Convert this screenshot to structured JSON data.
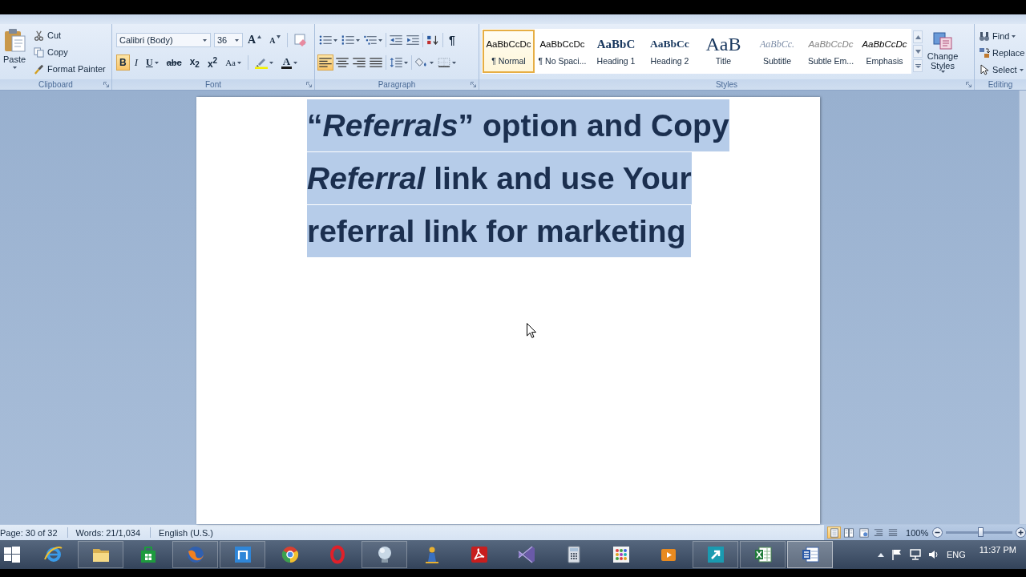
{
  "ribbon": {
    "clipboard": {
      "label": "Clipboard",
      "paste": "Paste",
      "actions": [
        {
          "kind": "cut",
          "label": "Cut"
        },
        {
          "kind": "copy",
          "label": "Copy"
        },
        {
          "kind": "format-painter",
          "label": "Format Painter"
        }
      ]
    },
    "font": {
      "label": "Font",
      "font_name": "Calibri (Body)",
      "font_size": "36",
      "size_tools": [
        {
          "kind": "grow",
          "label": "A"
        },
        {
          "kind": "shrink",
          "label": "A"
        },
        {
          "kind": "clear"
        }
      ],
      "format": [
        {
          "kind": "bold",
          "label": "B",
          "selected": true
        },
        {
          "kind": "italic",
          "label": "I",
          "selected": false
        },
        {
          "kind": "underline",
          "label": "U",
          "selected": false
        },
        {
          "kind": "strikethrough",
          "label": "abc",
          "selected": false
        },
        {
          "kind": "subscript",
          "label": "x$_{2}$",
          "selected": false
        },
        {
          "kind": "superscript",
          "label": "x$^{2}$",
          "selected": false
        },
        {
          "kind": "change-case",
          "label": "Aa"
        }
      ],
      "colors": [
        {
          "kind": "highlight"
        },
        {
          "kind": "font-color",
          "label": "A"
        }
      ]
    },
    "paragraph": {
      "label": "Paragraph",
      "top_row": [
        {
          "kind": "bullets",
          "selected": false
        },
        {
          "kind": "numbering",
          "selected": false
        },
        {
          "kind": "multilevel",
          "selected": false
        },
        {
          "kind": "decrease-indent"
        },
        {
          "kind": "increase-indent"
        },
        {
          "kind": "sort"
        },
        {
          "kind": "show-hide",
          "label": "¶",
          "selected": false
        }
      ],
      "bottom_row": [
        {
          "kind": "align-left",
          "selected": true
        },
        {
          "kind": "align-center",
          "selected": false
        },
        {
          "kind": "align-right",
          "selected": false
        },
        {
          "kind": "justify",
          "selected": false
        },
        {
          "kind": "line-spacing"
        },
        {
          "kind": "shading"
        },
        {
          "kind": "borders"
        }
      ]
    },
    "styles": {
      "label": "Styles",
      "items": [
        {
          "kind": "normal",
          "preview": "AaBbCcDc",
          "name": "¶ Normal",
          "selected": true
        },
        {
          "kind": "no-spacing",
          "preview": "AaBbCcDc",
          "name": "¶ No Spaci...",
          "selected": false
        },
        {
          "kind": "heading-1",
          "preview": "AaBbC",
          "name": "Heading 1",
          "selected": false
        },
        {
          "kind": "heading-2",
          "preview": "AaBbCc",
          "name": "Heading 2",
          "selected": false
        },
        {
          "kind": "title",
          "preview": "AaB",
          "name": "Title",
          "selected": false
        },
        {
          "kind": "subtitle",
          "preview": "AaBbCc.",
          "name": "Subtitle",
          "selected": false
        },
        {
          "kind": "subtle-emphasis",
          "preview": "AaBbCcDc",
          "name": "Subtle Em...",
          "selected": false
        },
        {
          "kind": "emphasis",
          "preview": "AaBbCcDc",
          "name": "Emphasis",
          "selected": false
        }
      ],
      "change_styles": "Change Styles"
    },
    "editing": {
      "label": "Editing",
      "actions": [
        {
          "kind": "find",
          "label": "Find"
        },
        {
          "kind": "replace",
          "label": "Replace"
        },
        {
          "kind": "select",
          "label": "Select"
        }
      ]
    }
  },
  "document": {
    "paragraph": "“*Referrals*” option and Copy *Referral* link and use Your referral link for marketing",
    "selected": true
  },
  "status_bar": {
    "page": "Page: 30 of 32",
    "words": "Words: 21/1,034",
    "language": "English (U.S.)",
    "views": [
      {
        "kind": "print-layout",
        "selected": true
      },
      {
        "kind": "full-screen",
        "selected": false
      },
      {
        "kind": "web-layout",
        "selected": false
      },
      {
        "kind": "outline",
        "selected": false
      },
      {
        "kind": "draft",
        "selected": false
      }
    ],
    "zoom": "100%",
    "zoom_slider": {
      "level": 0.52
    }
  },
  "taskbar": {
    "apps": [
      {
        "kind": "browser",
        "open": false,
        "selected": false
      },
      {
        "kind": "folder",
        "open": true,
        "selected": false
      },
      {
        "kind": "store",
        "open": false,
        "selected": false
      },
      {
        "kind": "globe",
        "open": true,
        "selected": false
      },
      {
        "kind": "window",
        "open": true,
        "selected": false
      },
      {
        "kind": "pinwheel",
        "open": false,
        "selected": false
      },
      {
        "kind": "ring",
        "open": false,
        "selected": false
      },
      {
        "kind": "sphere",
        "open": true,
        "selected": false
      },
      {
        "kind": "figure",
        "open": false,
        "selected": false
      },
      {
        "kind": "swirl",
        "open": false,
        "selected": false
      },
      {
        "kind": "knot",
        "open": false,
        "selected": false
      },
      {
        "kind": "calculator",
        "open": false,
        "selected": false
      },
      {
        "kind": "grid",
        "open": false,
        "selected": false
      },
      {
        "kind": "media",
        "open": false,
        "selected": false
      },
      {
        "kind": "arrow",
        "open": true,
        "selected": false
      },
      {
        "kind": "spreadsheet",
        "open": true,
        "selected": false
      },
      {
        "kind": "document",
        "open": true,
        "selected": true
      }
    ],
    "language": "ENG",
    "time": "11:37 PM"
  }
}
